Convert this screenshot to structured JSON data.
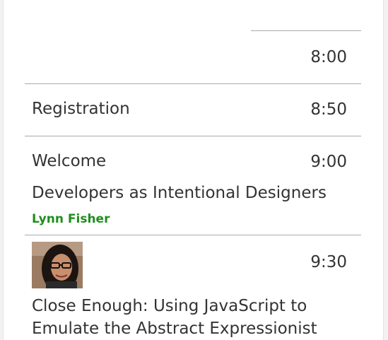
{
  "schedule": {
    "slot_0": {
      "time": "8:00"
    },
    "slot_1": {
      "title": "Registration",
      "time": "8:50"
    },
    "slot_2": {
      "title": "Welcome",
      "time": "9:00",
      "talk_title": "Developers as Intentional Designers",
      "speaker": "Lynn Fisher"
    },
    "slot_3": {
      "time": "9:30",
      "talk_title_line1": "Close Enough: Using JavaScript to",
      "talk_title_line2": "Emulate the Abstract Expressionist"
    }
  },
  "colors": {
    "speaker_link": "#1e8e1e",
    "text": "#333333",
    "divider": "#aaaaaa"
  }
}
